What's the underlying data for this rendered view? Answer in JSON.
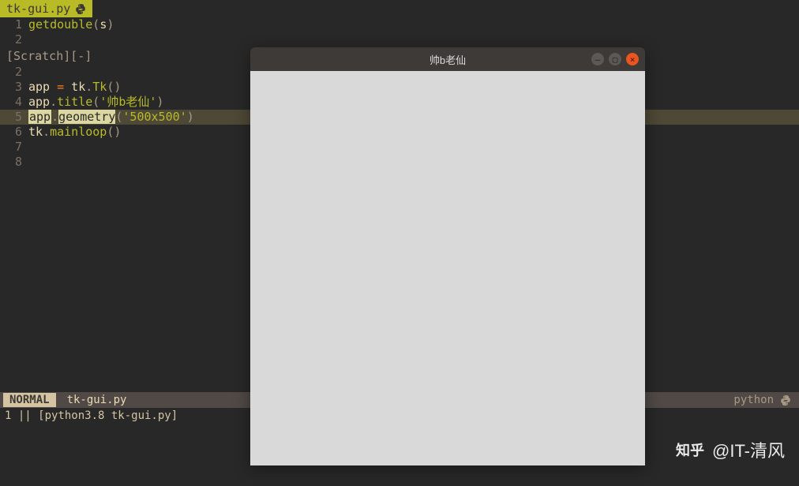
{
  "tab": {
    "filename": "tk-gui.py"
  },
  "buffer1": {
    "lines": [
      {
        "n": "1",
        "tokens": [
          {
            "t": "getdouble",
            "c": "tk-func"
          },
          {
            "t": "(",
            "c": "tk-punct"
          },
          {
            "t": "s",
            "c": "tk-ident"
          },
          {
            "t": ")",
            "c": "tk-punct"
          }
        ]
      },
      {
        "n": "2",
        "tokens": []
      }
    ]
  },
  "scratch": {
    "label": "[Scratch][-]"
  },
  "buffer2": {
    "lines": [
      {
        "n": "2",
        "hl": false,
        "tokens": []
      },
      {
        "n": "3",
        "hl": false,
        "tokens": [
          {
            "t": "app ",
            "c": "tk-ident"
          },
          {
            "t": "=",
            "c": "tk-op"
          },
          {
            "t": " tk",
            "c": "tk-ident"
          },
          {
            "t": ".",
            "c": "tk-punct"
          },
          {
            "t": "Tk",
            "c": "tk-func"
          },
          {
            "t": "()",
            "c": "tk-punct"
          }
        ]
      },
      {
        "n": "4",
        "hl": false,
        "tokens": [
          {
            "t": "app",
            "c": "tk-ident"
          },
          {
            "t": ".",
            "c": "tk-punct"
          },
          {
            "t": "title",
            "c": "tk-func"
          },
          {
            "t": "(",
            "c": "tk-punct"
          },
          {
            "t": "'帅b老仙'",
            "c": "tk-string"
          },
          {
            "t": ")",
            "c": "tk-punct"
          }
        ]
      },
      {
        "n": "5",
        "hl": true,
        "tokens": [
          {
            "t": "app",
            "c": "sel1"
          },
          {
            "t": ".",
            "c": "tk-punct"
          },
          {
            "t": "geometry",
            "c": "sel2"
          },
          {
            "t": "(",
            "c": "tk-punct"
          },
          {
            "t": "'500x500'",
            "c": "tk-string"
          },
          {
            "t": ")",
            "c": "tk-punct"
          }
        ]
      },
      {
        "n": "6",
        "hl": false,
        "tokens": [
          {
            "t": "tk",
            "c": "tk-ident"
          },
          {
            "t": ".",
            "c": "tk-punct"
          },
          {
            "t": "mainloop",
            "c": "tk-func"
          },
          {
            "t": "()",
            "c": "tk-punct"
          }
        ]
      },
      {
        "n": "7",
        "hl": false,
        "tokens": []
      },
      {
        "n": "8",
        "hl": false,
        "tokens": []
      }
    ]
  },
  "status": {
    "mode": "NORMAL",
    "file": "tk-gui.py",
    "lang": "python"
  },
  "cmdline": "1 ||  [python3.8 tk-gui.py]",
  "tkwin": {
    "title": "帅b老仙"
  },
  "watermark": {
    "brand": "知乎",
    "handle": "@IT-清风"
  }
}
